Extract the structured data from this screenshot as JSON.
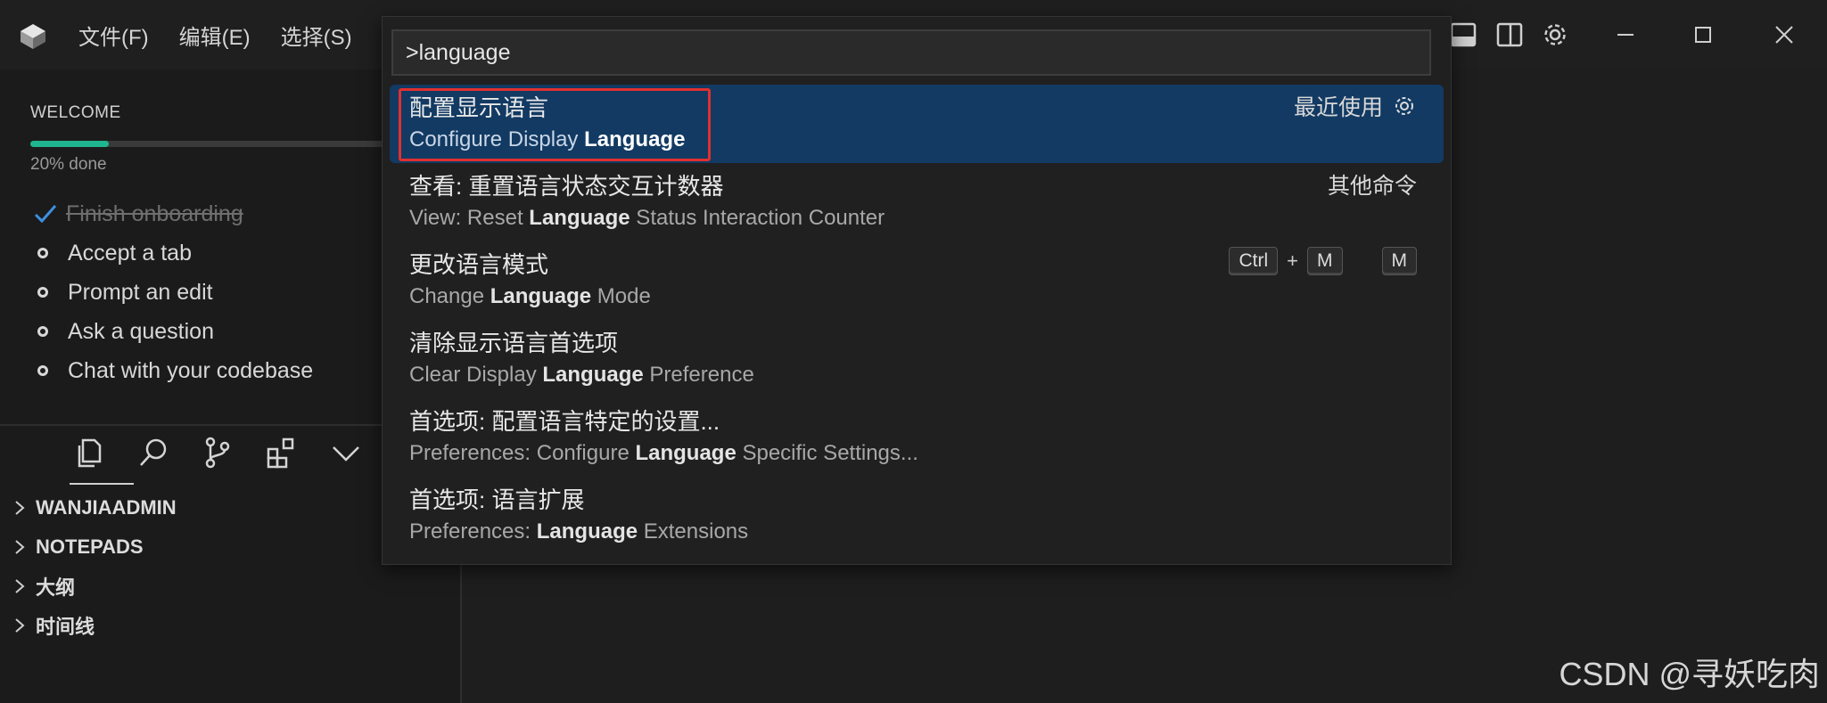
{
  "titlebar": {
    "menu": [
      "文件(F)",
      "编辑(E)",
      "选择(S)"
    ],
    "icons": [
      "app-logo-icon",
      "toggle-panel-icon",
      "toggle-sidebar-icon",
      "settings-gear-icon",
      "minimize-icon",
      "maximize-icon",
      "close-icon"
    ]
  },
  "welcome": {
    "title": "WELCOME",
    "progress_fraction": 0.2,
    "progress_text": "20% done",
    "steps": [
      {
        "label": "Finish onboarding",
        "done": true
      },
      {
        "label": "Accept a tab",
        "done": false
      },
      {
        "label": "Prompt an edit",
        "done": false
      },
      {
        "label": "Ask a question",
        "done": false
      },
      {
        "label": "Chat with your codebase",
        "done": false
      }
    ]
  },
  "activity_bar": [
    "files-icon",
    "search-icon",
    "source-control-icon",
    "extensions-icon",
    "chevron-down-icon"
  ],
  "tree": [
    "WANJIAADMIN",
    "NOTEPADS",
    "大纲",
    "时间线"
  ],
  "palette": {
    "input_value": ">language",
    "items": [
      {
        "zh": "配置显示语言",
        "en_pre": "Configure Display ",
        "en_bold": "Language",
        "en_post": "",
        "right": "最近使用",
        "selected": true
      },
      {
        "zh": "查看: 重置语言状态交互计数器",
        "en_pre": "View: Reset ",
        "en_bold": "Language",
        "en_post": " Status Interaction Counter",
        "right": "其他命令",
        "selected": false
      },
      {
        "zh": "更改语言模式",
        "en_pre": "Change ",
        "en_bold": "Language",
        "en_post": " Mode",
        "keys": [
          "Ctrl",
          "+",
          "M",
          "M"
        ],
        "selected": false
      },
      {
        "zh": "清除显示语言首选项",
        "en_pre": "Clear Display ",
        "en_bold": "Language",
        "en_post": " Preference",
        "selected": false
      },
      {
        "zh": "首选项: 配置语言特定的设置...",
        "en_pre": "Preferences: Configure ",
        "en_bold": "Language",
        "en_post": " Specific Settings...",
        "selected": false
      },
      {
        "zh": "首选项: 语言扩展",
        "en_pre": "Preferences: ",
        "en_bold": "Language",
        "en_post": " Extensions",
        "selected": false
      }
    ]
  },
  "watermark": "CSDN @寻妖吃肉",
  "colors": {
    "accent_progress": "#1fb58f",
    "selection": "#123a63",
    "highlight_box": "#e03030"
  }
}
